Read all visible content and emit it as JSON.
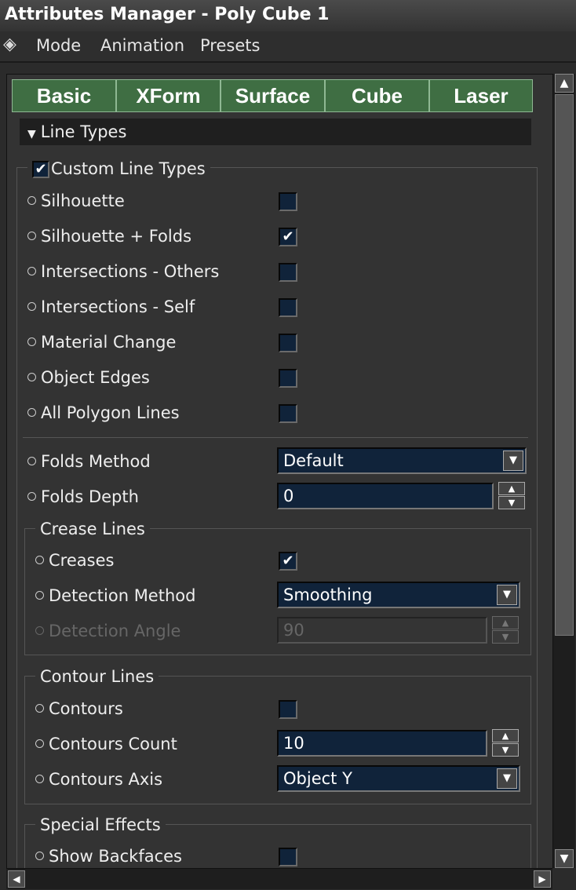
{
  "window": {
    "title": "Attributes Manager - Poly Cube 1"
  },
  "menu": {
    "items": [
      "Mode",
      "Animation",
      "Presets"
    ]
  },
  "tabs": [
    "Basic",
    "XForm",
    "Surface",
    "Cube",
    "Laser"
  ],
  "section": {
    "title": "Line Types"
  },
  "custom_line_types": {
    "label": "Custom Line Types",
    "checked": true,
    "rows": [
      {
        "label": "Silhouette",
        "checked": false
      },
      {
        "label": "Silhouette + Folds",
        "checked": true
      },
      {
        "label": "Intersections - Others",
        "checked": false
      },
      {
        "label": "Intersections - Self",
        "checked": false
      },
      {
        "label": "Material Change",
        "checked": false
      },
      {
        "label": "Object Edges",
        "checked": false
      },
      {
        "label": "All Polygon Lines",
        "checked": false
      }
    ],
    "folds_method": {
      "label": "Folds Method",
      "value": "Default"
    },
    "folds_depth": {
      "label": "Folds Depth",
      "value": "0"
    }
  },
  "crease_lines": {
    "title": "Crease Lines",
    "creases": {
      "label": "Creases",
      "checked": true
    },
    "detection_method": {
      "label": "Detection Method",
      "value": "Smoothing"
    },
    "detection_angle": {
      "label": "Detection Angle",
      "value": "90"
    }
  },
  "contour_lines": {
    "title": "Contour Lines",
    "contours": {
      "label": "Contours",
      "checked": false
    },
    "contours_count": {
      "label": "Contours Count",
      "value": "10"
    },
    "contours_axis": {
      "label": "Contours Axis",
      "value": "Object Y"
    }
  },
  "special_effects": {
    "title": "Special Effects",
    "show_backfaces": {
      "label": "Show Backfaces",
      "checked": false
    }
  },
  "colors": {
    "tab_bg": "#3f6e43",
    "field_bg": "#10233a",
    "panel_bg": "#333333"
  }
}
